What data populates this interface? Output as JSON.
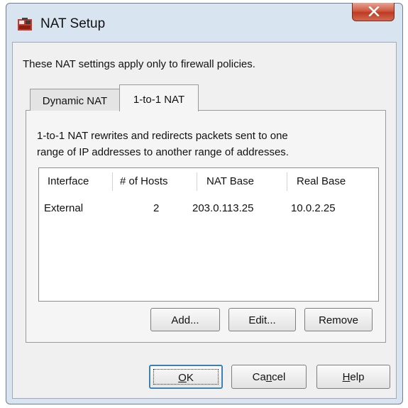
{
  "window": {
    "title": "NAT Setup",
    "icons": {
      "app": "firewall-app-icon",
      "close": "close-x-icon"
    },
    "colors": {
      "close": "#c7482f",
      "frame": "#d9e4f1",
      "client": "#f0f0f0"
    }
  },
  "description": "These NAT settings apply only to firewall policies.",
  "tabs": [
    {
      "label": "Dynamic NAT",
      "selected": false
    },
    {
      "label": "1-to-1 NAT",
      "selected": true
    }
  ],
  "panel": {
    "description_line1": "1-to-1 NAT rewrites and redirects packets sent to one",
    "description_line2": "range of IP addresses to another range of addresses."
  },
  "table": {
    "columns": [
      "Interface",
      "# of Hosts",
      "NAT Base",
      "Real Base"
    ],
    "rows": [
      [
        "External",
        "2",
        "203.0.113.25",
        "10.0.2.25"
      ]
    ]
  },
  "buttons": {
    "add": "Add...",
    "edit": "Edit...",
    "remove": "Remove",
    "ok_mnemonic": "O",
    "ok_rest": "K",
    "cancel_pre": "Ca",
    "cancel_mnemonic": "n",
    "cancel_post": "cel",
    "help_mnemonic": "H",
    "help_rest": "elp"
  }
}
